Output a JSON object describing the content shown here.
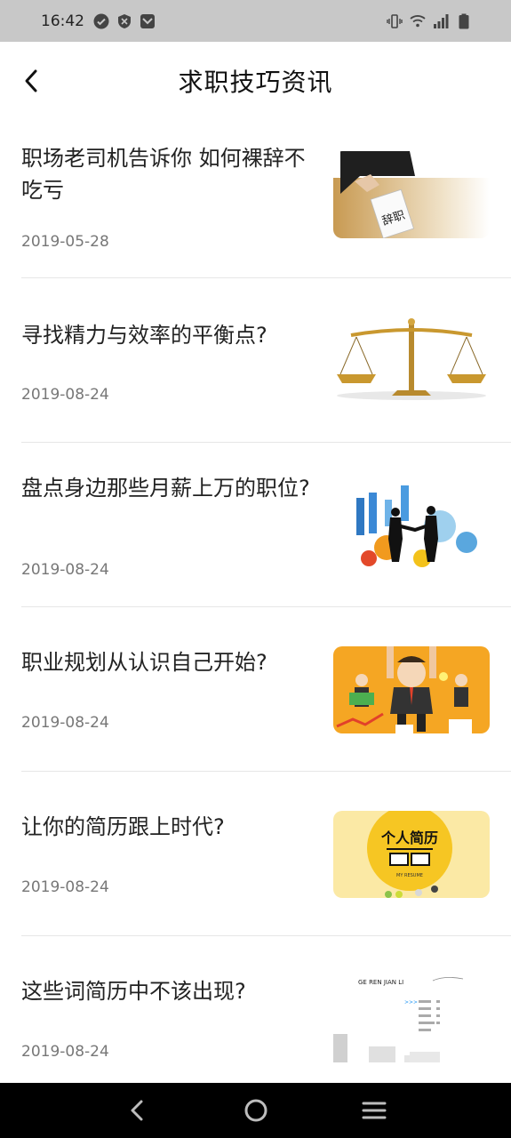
{
  "status_bar": {
    "time": "16:42",
    "left_icons": [
      "check-circle-icon",
      "shield-icon",
      "app-notification-icon"
    ],
    "right_icons": [
      "vibrate-icon",
      "wifi-icon",
      "signal-icon",
      "battery-icon"
    ]
  },
  "header": {
    "title": "求职技巧资讯",
    "back_icon": "chevron-left-icon"
  },
  "articles": [
    {
      "title": "职场老司机告诉你 如何裸辞不吃亏",
      "date": "2019-05-28",
      "thumb_text": "辞职"
    },
    {
      "title": "寻找精力与效率的平衡点?",
      "date": "2019-08-24"
    },
    {
      "title": "盘点身边那些月薪上万的职位?",
      "date": "2019-08-24"
    },
    {
      "title": "职业规划从认识自己开始?",
      "date": "2019-08-24"
    },
    {
      "title": "让你的简历跟上时代?",
      "date": "2019-08-24",
      "thumb_text": "个人简历",
      "thumb_sub": "MY RESUME"
    },
    {
      "title": "这些词简历中不该出现?",
      "date": "2019-08-24",
      "thumb_text": "GE REN JIAN LI"
    }
  ],
  "nav_bar": {
    "icons": [
      "back-icon",
      "home-icon",
      "menu-icon"
    ]
  },
  "colors": {
    "status_bar_bg": "#c8c8c8",
    "divider": "#e6e6e6",
    "date_text": "#777777",
    "nav_bar_bg": "#000000"
  }
}
